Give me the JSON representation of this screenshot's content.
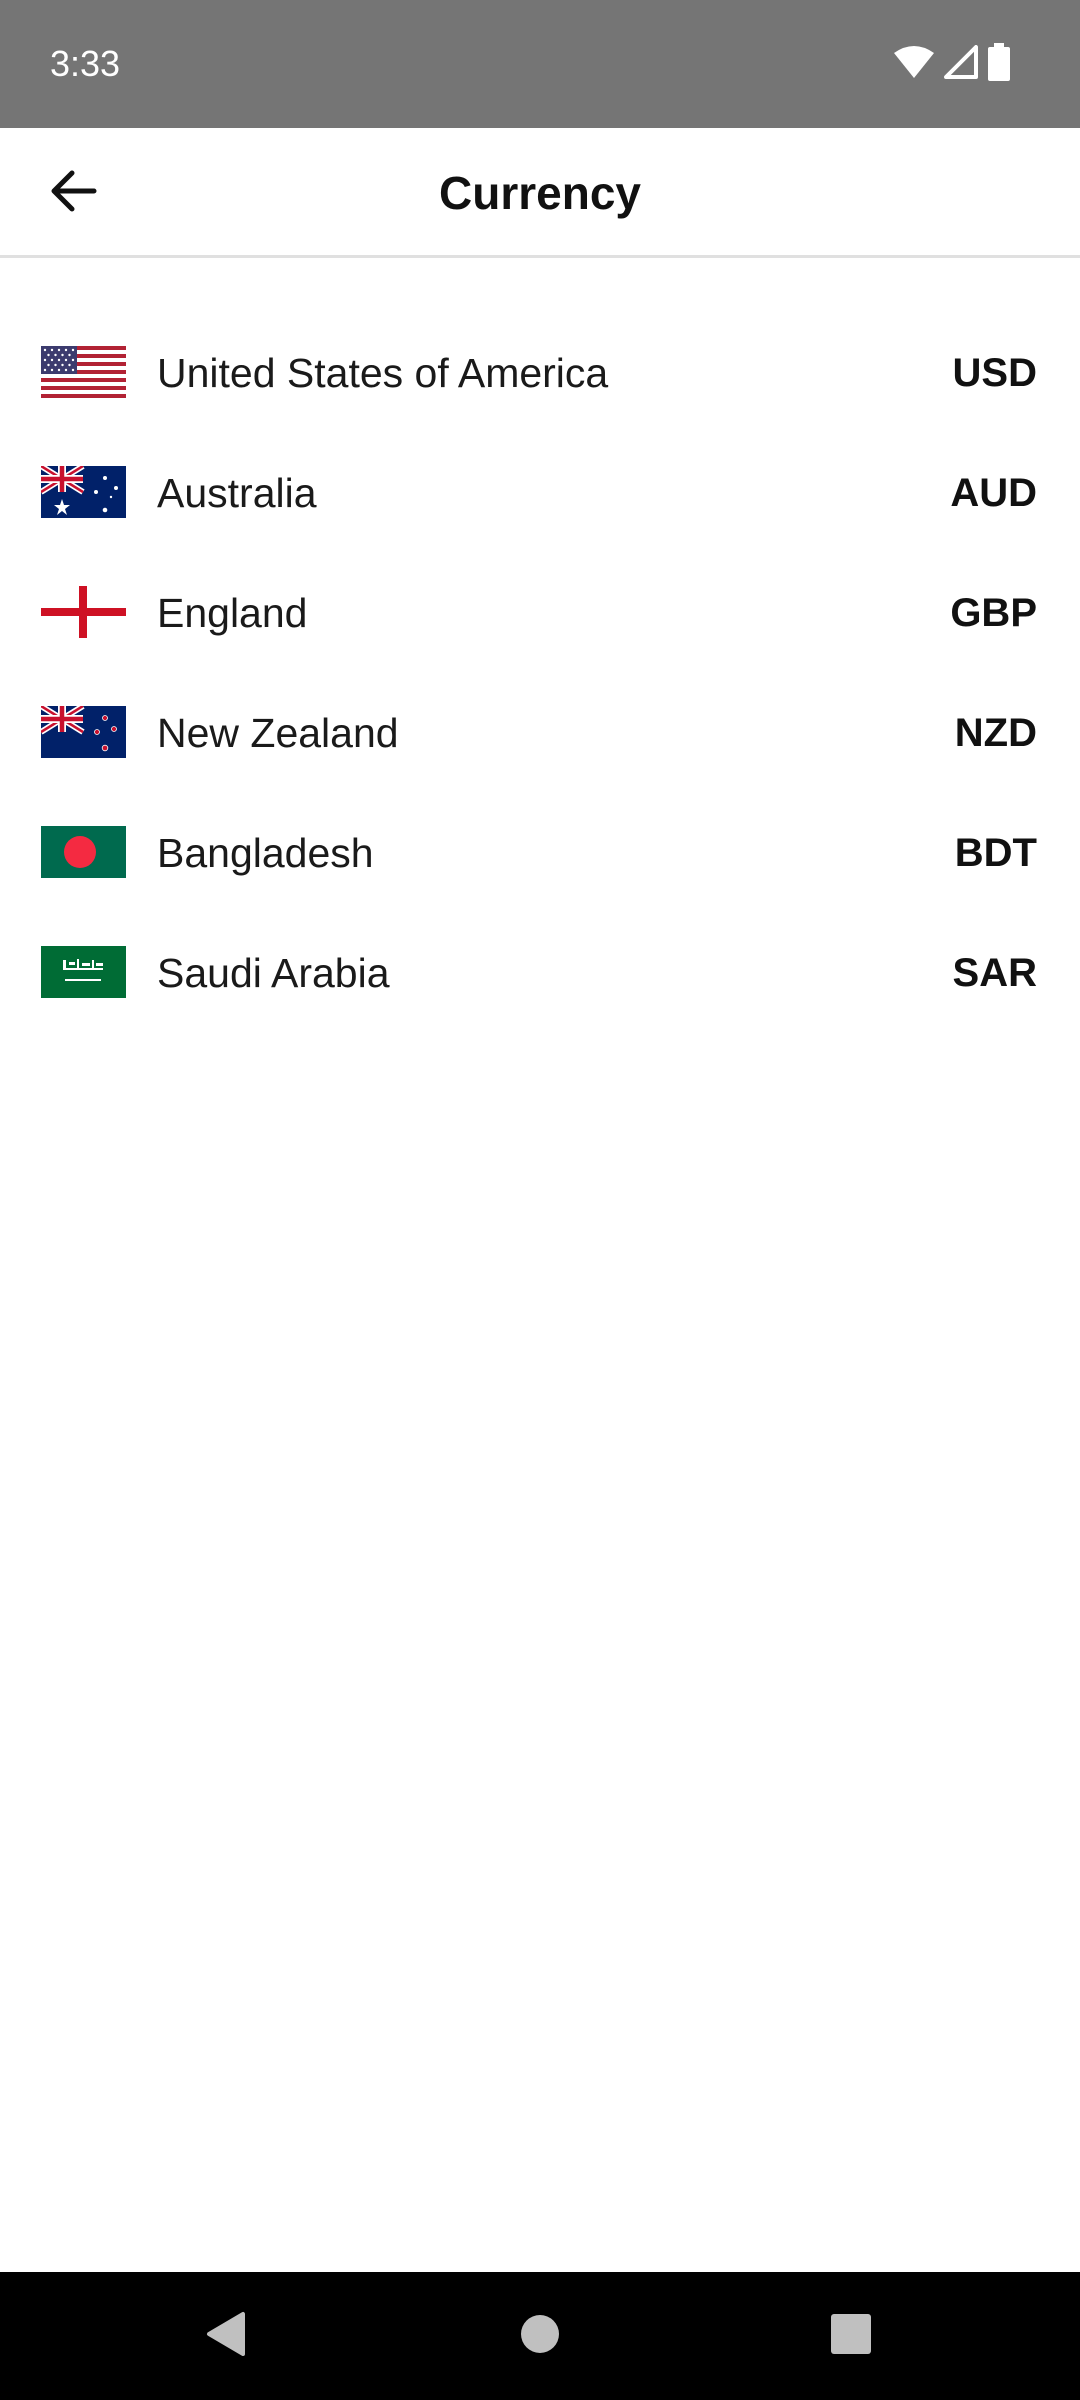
{
  "status_bar": {
    "time": "3:33",
    "icons": [
      "wifi-icon",
      "signal-icon",
      "battery-icon"
    ]
  },
  "app_bar": {
    "title": "Currency",
    "back_icon": "arrow-back-icon"
  },
  "currencies": [
    {
      "country": "United States of America",
      "code": "USD",
      "flag": "us-flag-icon"
    },
    {
      "country": "Australia",
      "code": "AUD",
      "flag": "australia-flag-icon"
    },
    {
      "country": "England",
      "code": "GBP",
      "flag": "england-flag-icon"
    },
    {
      "country": "New Zealand",
      "code": "NZD",
      "flag": "new-zealand-flag-icon"
    },
    {
      "country": "Bangladesh",
      "code": "BDT",
      "flag": "bangladesh-flag-icon"
    },
    {
      "country": "Saudi Arabia",
      "code": "SAR",
      "flag": "saudi-arabia-flag-icon"
    }
  ],
  "nav_bar": {
    "buttons": [
      "back-triangle-icon",
      "home-circle-icon",
      "recents-square-icon"
    ]
  },
  "colors": {
    "status_bar_bg": "#757575",
    "nav_bar_bg": "#000000",
    "divider": "#e0e0e0",
    "text_primary": "#111111"
  }
}
